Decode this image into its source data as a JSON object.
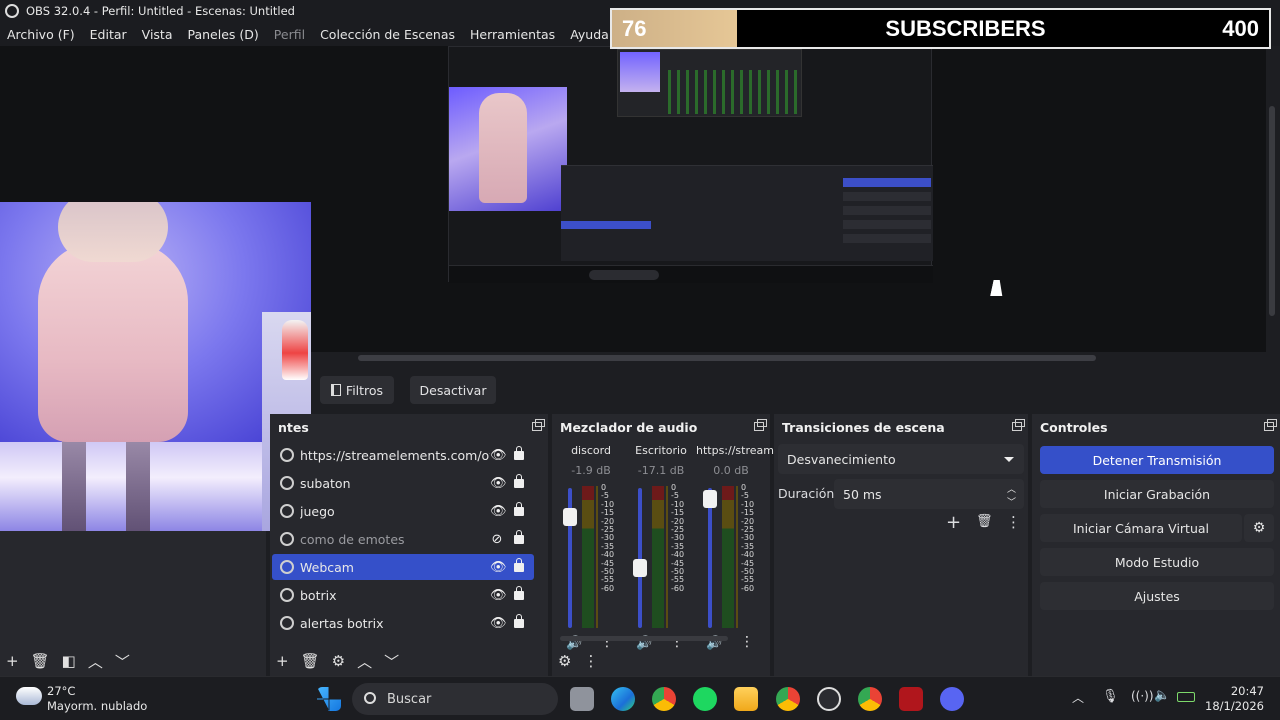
{
  "window": {
    "title": "OBS 32.0.4 - Perfil: Untitled - Escenas: Untitled"
  },
  "menu": [
    "Archivo (F)",
    "Editar",
    "Vista",
    "Paneles (D)",
    "Perfil",
    "Colección de Escenas",
    "Herramientas",
    "Ayuda (H)"
  ],
  "subscriber_goal": {
    "current": "76",
    "label": "SUBSCRIBERS",
    "goal": "400",
    "progress": 0.19
  },
  "source_toolbar": {
    "filters": "Filtros",
    "deactivate": "Desactivar"
  },
  "sources": {
    "title": "ntes",
    "items": [
      {
        "name": "https://streamelements.com/ov",
        "visible": true,
        "selected": false
      },
      {
        "name": "subaton",
        "visible": true,
        "selected": false
      },
      {
        "name": "juego",
        "visible": true,
        "selected": false
      },
      {
        "name": "como de emotes",
        "visible": false,
        "selected": false
      },
      {
        "name": "Webcam",
        "visible": true,
        "selected": true
      },
      {
        "name": "botrix",
        "visible": true,
        "selected": false
      },
      {
        "name": "alertas botrix",
        "visible": true,
        "selected": false
      }
    ]
  },
  "mixer": {
    "title": "Mezclador de audio",
    "scale": [
      "0",
      "-5",
      "-10",
      "-15",
      "-20",
      "-25",
      "-30",
      "-35",
      "-40",
      "-45",
      "-50",
      "-55",
      "-60"
    ],
    "channels": [
      {
        "name": "discord",
        "db": "-1.9 dB",
        "level": 0.79
      },
      {
        "name": "Escritorio",
        "db": "-17.1 dB",
        "level": 0.43
      },
      {
        "name": "https://stream",
        "db": "0.0 dB",
        "level": 0.92
      }
    ]
  },
  "transitions": {
    "title": "Transiciones de escena",
    "selected": "Desvanecimiento",
    "duration_label": "Duración",
    "duration_value": "50 ms"
  },
  "controls": {
    "title": "Controles",
    "stop_stream": "Detener Transmisión",
    "start_recording": "Iniciar Grabación",
    "start_virtual_cam": "Iniciar Cámara Virtual",
    "studio_mode": "Modo Estudio",
    "settings": "Ajustes"
  },
  "taskbar": {
    "temp": "27°C",
    "weather": "Mayorm. nublado",
    "search_placeholder": "Buscar",
    "time": "20:47",
    "date": "18/1/2026"
  },
  "colors": {
    "accent": "#3550c9",
    "panel": "#27282d",
    "background": "#1d1e22"
  }
}
